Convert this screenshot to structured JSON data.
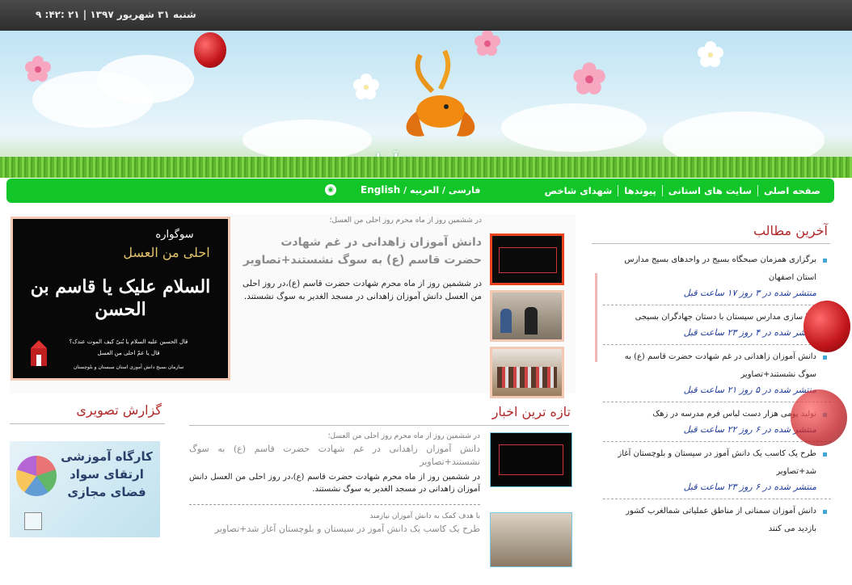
{
  "topbar": {
    "date": "شنبه ۳۱ شهریور ۱۳۹۷ | ۲۱ :۴۲: ۹"
  },
  "banner": {
    "title": "سپیده آرمانی"
  },
  "nav": {
    "items": [
      "صفحه اصلی",
      "سایت های استانی",
      "پیوندها",
      "شهدای شاخص"
    ],
    "lang": "فارسی / العربیه /",
    "lang_en": "English",
    "rss_icon": "rss-icon"
  },
  "latest": {
    "heading": "آخرین مطالب",
    "posts": [
      {
        "title": "برگزاری همزمان صبحگاه بسیج در واحدهای بسیج مدارس استان اصفهان",
        "meta": "منتشر شده در ۳ روز ۱۷ ساعت قبل"
      },
      {
        "title": "زیبا سازی مدارس سیستان با دستان جهادگران بسیجی",
        "meta": "منتشر شده در ۴ روز ۲۳ ساعت قبل"
      },
      {
        "title": "دانش آموزان زاهدانی در غم شهادت حضرت قاسم (ع) به سوگ نشستند+تصاویر",
        "meta": "منتشر شده در ۵ روز ۲۱ ساعت قبل"
      },
      {
        "title": "تولید یومی هزار دست لباس فرم مدرسه در زهک",
        "meta": "منتشر شده در ۶ روز ۲۲ ساعت قبل"
      },
      {
        "title": "طرح یک کاسب یک دانش آموز در سیستان و بلوچستان آغاز شد+تصاویر",
        "meta": "منتشر شده در ۶ روز ۲۳ ساعت قبل"
      },
      {
        "title": "دانش آموزان سمنانی از مناطق عملیاتی شمالغرب کشور بازدید می کنند",
        "meta": ""
      }
    ]
  },
  "featured": {
    "supertitle": "در ششمین روز از ماه محرم روز احلی من العسل؛",
    "title": "دانش آموزان زاهدانی در غم شهادت حضرت قاسم (ع) به سوگ نشستند+تصاویر",
    "summary": "در ششمین روز از ماه محرم شهادت حضرت قاسم (ع)،در روز احلی من العسل دانش آموزان زاهدانی در مسجد الغدیر به سوگ نشستند.",
    "image_text": {
      "top": "سوگواره",
      "middle": "احلی من العسل",
      "big": "السلام علیک یا قاسم بن الحسن",
      "caption": "قال الحسین علیه السلام یا بُنیّ کیف الموت عندک؟",
      "caption2": "قال یا عمّ احلی من العسل",
      "org": "سازمان بسیج دانش آموزی استان سیستان و بلوچستان"
    }
  },
  "photo_report": {
    "heading": "گزارش تصویری",
    "poster_line1": "کارگاه آموزشی",
    "poster_line2": "ارتقای سواد",
    "poster_line3": "فضای مجازی"
  },
  "news": {
    "heading": "تازه ترین اخبار",
    "items": [
      {
        "supertitle": "در ششمین روز از ماه محرم روز احلی من العسل؛",
        "title": "دانش آموزان زاهدانی در غم شهادت حضرت قاسم (ع) به سوگ نشستند+تصاویر",
        "summary": "در ششمین روز از ماه محرم شهادت حضرت قاسم (ع)،در روز احلی من العسل دانش آموزان زاهدانی در مسجد الغدیر به سوگ نشستند."
      },
      {
        "supertitle": "با هدف کمک به دانش آموزان نیازمند",
        "title": "طرح یک کاسب یک دانش آموز در سیستان و بلوچستان آغاز شد+تصاویر",
        "summary": ""
      }
    ]
  },
  "colors": {
    "nav_green": "#12c62a",
    "heading_red": "#b02a2a",
    "meta_blue": "#1f3d9c",
    "frame_peach": "#f3c9b4"
  }
}
